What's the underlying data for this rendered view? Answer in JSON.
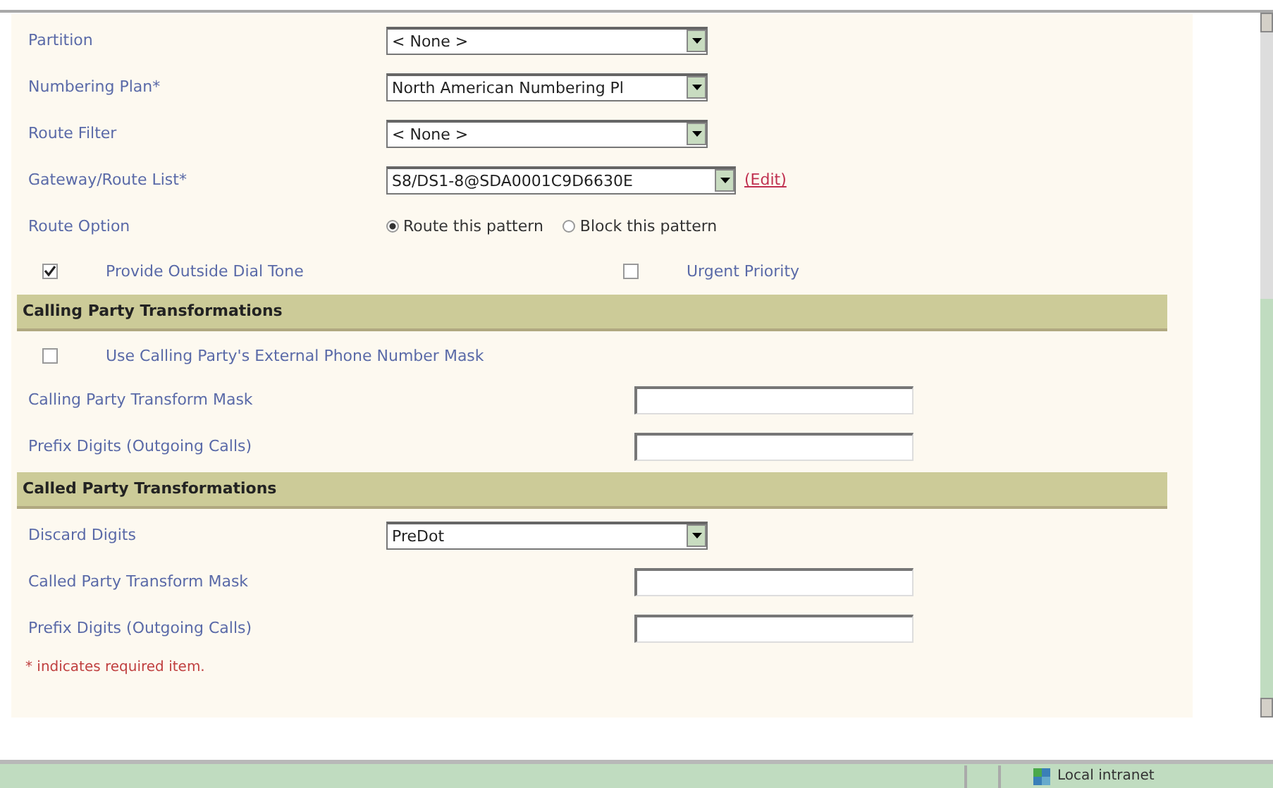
{
  "rows": [
    {
      "kind": "select",
      "label": "Partition",
      "value": "< None >"
    },
    {
      "kind": "select",
      "label": "Numbering Plan*",
      "value": "North American Numbering Pl"
    },
    {
      "kind": "select",
      "label": "Route Filter",
      "value": "< None >"
    },
    {
      "kind": "select",
      "label": "Gateway/Route List*",
      "value": "S8/DS1-8@SDA0001C9D6630E",
      "link": "(Edit)"
    },
    {
      "kind": "radio",
      "label": "Route Option",
      "options": [
        {
          "label": "Route this pattern",
          "selected": true
        },
        {
          "label": "Block this pattern",
          "selected": false
        }
      ]
    },
    {
      "kind": "checkpair",
      "items": [
        {
          "label": "Provide Outside Dial Tone",
          "checked": true
        },
        {
          "label": "Urgent Priority",
          "checked": false
        }
      ]
    },
    {
      "kind": "header",
      "title": "Calling Party Transformations"
    },
    {
      "kind": "checkbox",
      "label": "Use Calling Party's External Phone Number Mask",
      "checked": false
    },
    {
      "kind": "text",
      "label": "Calling Party Transform Mask"
    },
    {
      "kind": "text",
      "label": "Prefix Digits (Outgoing Calls)"
    },
    {
      "kind": "header",
      "title": "Called Party Transformations"
    },
    {
      "kind": "select",
      "label": "Discard Digits",
      "value": "PreDot"
    },
    {
      "kind": "text",
      "label": "Called Party Transform Mask"
    },
    {
      "kind": "text",
      "label": "Prefix Digits (Outgoing Calls)"
    }
  ],
  "note": "* indicates required item.",
  "status_bar": {
    "zone": "Local intranet"
  }
}
